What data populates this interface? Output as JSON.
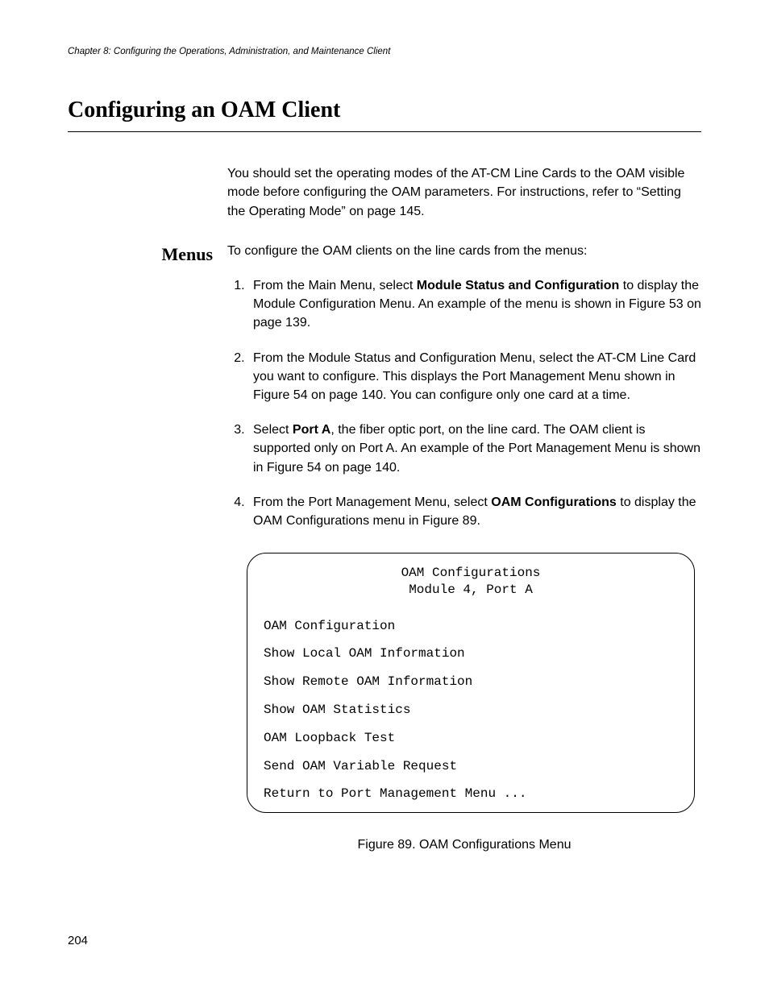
{
  "runningHeader": "Chapter 8: Configuring the Operations, Administration, and Maintenance Client",
  "sectionTitle": "Configuring an OAM Client",
  "intro": "You should set the operating modes of the AT-CM Line Cards to the OAM visible mode before configuring the OAM parameters. For instructions, refer to “Setting the Operating Mode” on page 145.",
  "sideLabel": "Menus",
  "menusIntro": "To configure the OAM clients on the line cards from the menus:",
  "steps": {
    "s1a": "From the Main Menu, select ",
    "s1bold": "Module Status and Configuration",
    "s1b": " to display the Module Configuration Menu. An example of the menu is shown in Figure 53 on page 139.",
    "s2": "From the Module Status and Configuration Menu, select the AT-CM Line Card you want to configure. This displays the Port Management Menu shown in Figure 54 on page 140. You can configure only one card at a time.",
    "s3a": "Select ",
    "s3bold": "Port A",
    "s3b": ", the fiber optic port, on the line card. The OAM client is supported only on Port A. An example of the Port Management Menu is shown in Figure 54 on page 140.",
    "s4a": "From the Port Management Menu, select ",
    "s4bold": "OAM Configurations",
    "s4b": " to display the OAM Configurations menu in Figure 89."
  },
  "menuBox": {
    "title1": "OAM Configurations",
    "title2": "Module 4, Port A",
    "items": [
      "OAM Configuration",
      "Show Local OAM Information",
      "Show Remote OAM Information",
      "Show OAM Statistics",
      "OAM Loopback Test",
      "Send OAM Variable Request",
      "Return to Port Management Menu ..."
    ]
  },
  "figureCaption": "Figure 89. OAM Configurations Menu",
  "pageNumber": "204"
}
